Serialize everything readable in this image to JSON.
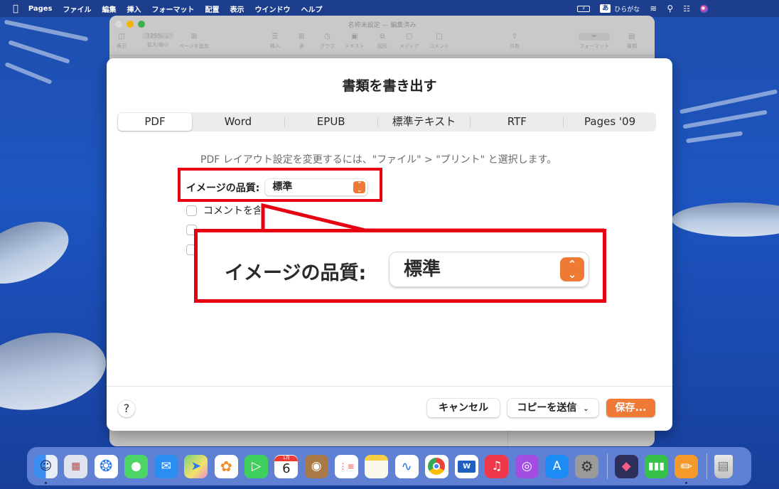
{
  "menubar": {
    "apple_icon": "apple-logo-icon",
    "app_name": "Pages",
    "items": [
      "ファイル",
      "編集",
      "挿入",
      "フォーマット",
      "配置",
      "表示",
      "ウインドウ",
      "ヘルプ"
    ],
    "status": {
      "battery_icon": "battery-charging-icon",
      "ime_badge": "あ",
      "ime_label": "ひらがな",
      "wifi_icon": "wifi-icon",
      "search_icon": "spotlight-search-icon",
      "control_center_icon": "control-center-icon",
      "siri_icon": "siri-icon"
    }
  },
  "pages_window": {
    "title": "名称未設定 — 編集済み",
    "toolbar": [
      {
        "icon": "sidebar-icon",
        "label": "表示"
      },
      {
        "icon": "zoom-dropdown",
        "label": "拡大/縮小",
        "value": "125%"
      },
      {
        "icon": "add-page-icon",
        "label": "ページを追加"
      },
      {
        "icon": "insert-icon",
        "label": "挿入"
      },
      {
        "icon": "table-icon",
        "label": "表"
      },
      {
        "icon": "chart-icon",
        "label": "グラフ"
      },
      {
        "icon": "text-icon",
        "label": "テキスト"
      },
      {
        "icon": "shape-icon",
        "label": "図形"
      },
      {
        "icon": "media-icon",
        "label": "メディア"
      },
      {
        "icon": "comment-icon",
        "label": "コメント"
      },
      {
        "icon": "share-icon",
        "label": "共有"
      },
      {
        "icon": "format-icon",
        "label": "フォーマット"
      },
      {
        "icon": "document-icon",
        "label": "書類"
      }
    ]
  },
  "dialog": {
    "title": "書類を書き出す",
    "tabs": [
      {
        "label": "PDF",
        "active": true
      },
      {
        "label": "Word",
        "active": false
      },
      {
        "label": "EPUB",
        "active": false
      },
      {
        "label": "標準テキスト",
        "active": false
      },
      {
        "label": "RTF",
        "active": false
      },
      {
        "label": "Pages '09",
        "active": false
      }
    ],
    "hint": "PDF レイアウト設定を変更するには、\"ファイル\" > \"プリント\" と選択します。",
    "image_quality": {
      "label": "イメージの品質:",
      "value": "標準"
    },
    "checkboxes": [
      {
        "label": "コメントを含める",
        "visible_label": "コメントを含",
        "checked": false
      },
      {
        "label": "",
        "checked": false
      },
      {
        "label": "",
        "checked": false
      }
    ],
    "help_label": "?",
    "buttons": {
      "cancel": "キャンセル",
      "send_copy": "コピーを送信",
      "save": "保存..."
    }
  },
  "callout": {
    "label": "イメージの品質:",
    "value": "標準",
    "color": "#e60012"
  },
  "colors": {
    "accent": "#ee7a36",
    "menubar": "#1d3e8c"
  },
  "dock": {
    "apps": [
      {
        "name": "Finder",
        "icon": "finder-icon",
        "running": true
      },
      {
        "name": "Launchpad",
        "icon": "launchpad-icon"
      },
      {
        "name": "Safari",
        "icon": "safari-icon"
      },
      {
        "name": "Messages",
        "icon": "messages-icon"
      },
      {
        "name": "Mail",
        "icon": "mail-icon"
      },
      {
        "name": "Maps",
        "icon": "maps-icon"
      },
      {
        "name": "Photos",
        "icon": "photos-icon"
      },
      {
        "name": "FaceTime",
        "icon": "facetime-icon"
      },
      {
        "name": "Calendar",
        "icon": "calendar-icon",
        "month": "1月",
        "day": "6"
      },
      {
        "name": "Contacts",
        "icon": "contacts-icon"
      },
      {
        "name": "Reminders",
        "icon": "reminders-icon"
      },
      {
        "name": "Notes",
        "icon": "notes-icon"
      },
      {
        "name": "Freeform",
        "icon": "freeform-icon"
      },
      {
        "name": "Chrome",
        "icon": "chrome-icon"
      },
      {
        "name": "Word",
        "icon": "word-icon",
        "glyph": "W"
      },
      {
        "name": "Music",
        "icon": "music-icon"
      },
      {
        "name": "Podcasts",
        "icon": "podcasts-icon"
      },
      {
        "name": "App Store",
        "icon": "app-store-icon"
      },
      {
        "name": "System Settings",
        "icon": "system-settings-icon"
      },
      {
        "name": "Shortcuts",
        "icon": "shortcuts-icon"
      },
      {
        "name": "Numbers",
        "icon": "numbers-icon"
      },
      {
        "name": "Pages",
        "icon": "pages-icon",
        "running": true
      },
      {
        "name": "Trash",
        "icon": "trash-icon"
      }
    ]
  }
}
